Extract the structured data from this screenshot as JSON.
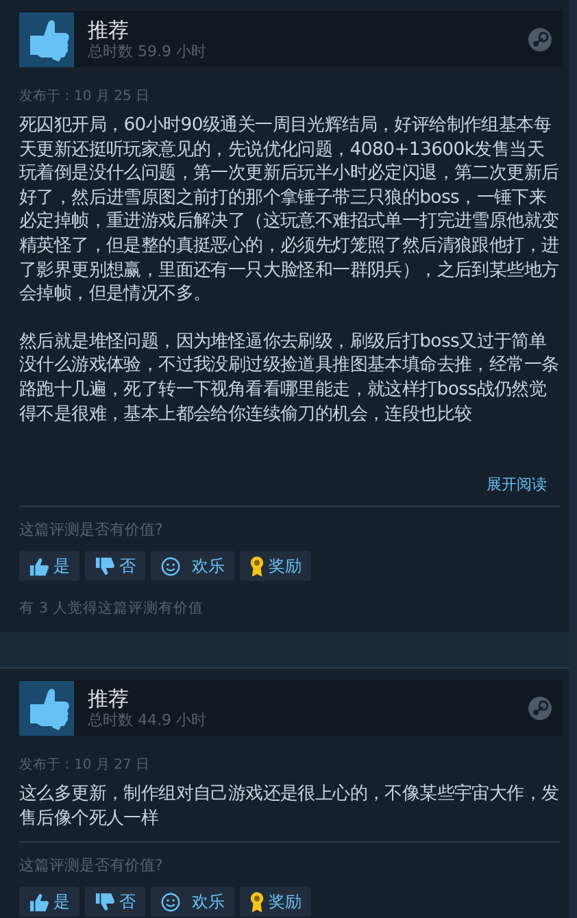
{
  "reviews": [
    {
      "verdict": "推荐",
      "playtime": "总时数 59.9 小时",
      "posted": "发布于：10 月 25 日",
      "truncated": true,
      "paragraphs": [
        "死囚犯开局，60小时90级通关一周目光辉结局，好评给制作组基本每天更新还挺听玩家意见的，先说优化问题，4080+13600k发售当天玩着倒是没什么问题，第一次更新后玩半小时必定闪退，第二次更新后好了，然后进雪原图之前打的那个拿锤子带三只狼的boss，一锤下来必定掉帧，重进游戏后解决了（这玩意不难招式单一打完进雪原他就变精英怪了，但是整的真挺恶心的，必须先灯笼照了然后清狼跟他打，进了影界更别想赢，里面还有一只大脸怪和一群阴兵），之后到某些地方会掉帧，但是情况不多。",
        "然后就是堆怪问题，因为堆怪逼你去刷级，刷级后打boss又过于简单没什么游戏体验，不过我没刷过级捡道具推图基本填命去推，经常一条路跑十几遍，死了转一下视角看看哪里能走，就这样打boss战仍然觉得不是很难，基本上都会给你连续偷刀的机会，连段也比较"
      ],
      "expand_link": "展开阅读",
      "helpful_prompt": "这篇评测是否有价值?",
      "buttons": [
        {
          "kind": "yes",
          "label": "是"
        },
        {
          "kind": "no",
          "label": "否"
        },
        {
          "kind": "funny",
          "label": "欢乐"
        },
        {
          "kind": "award",
          "label": "奖励"
        }
      ],
      "helpful_count": "有 3 人觉得这篇评测有价值"
    },
    {
      "verdict": "推荐",
      "playtime": "总时数 44.9 小时",
      "posted": "发布于：10 月 27 日",
      "truncated": false,
      "paragraphs": [
        "这么多更新，制作组对自己游戏还是很上心的，不像某些宇宙大作，发售后像个死人一样"
      ],
      "helpful_prompt": "这篇评测是否有价值?",
      "buttons": [
        {
          "kind": "yes",
          "label": "是"
        },
        {
          "kind": "no",
          "label": "否"
        },
        {
          "kind": "funny",
          "label": "欢乐"
        },
        {
          "kind": "award",
          "label": "奖励"
        }
      ]
    }
  ]
}
